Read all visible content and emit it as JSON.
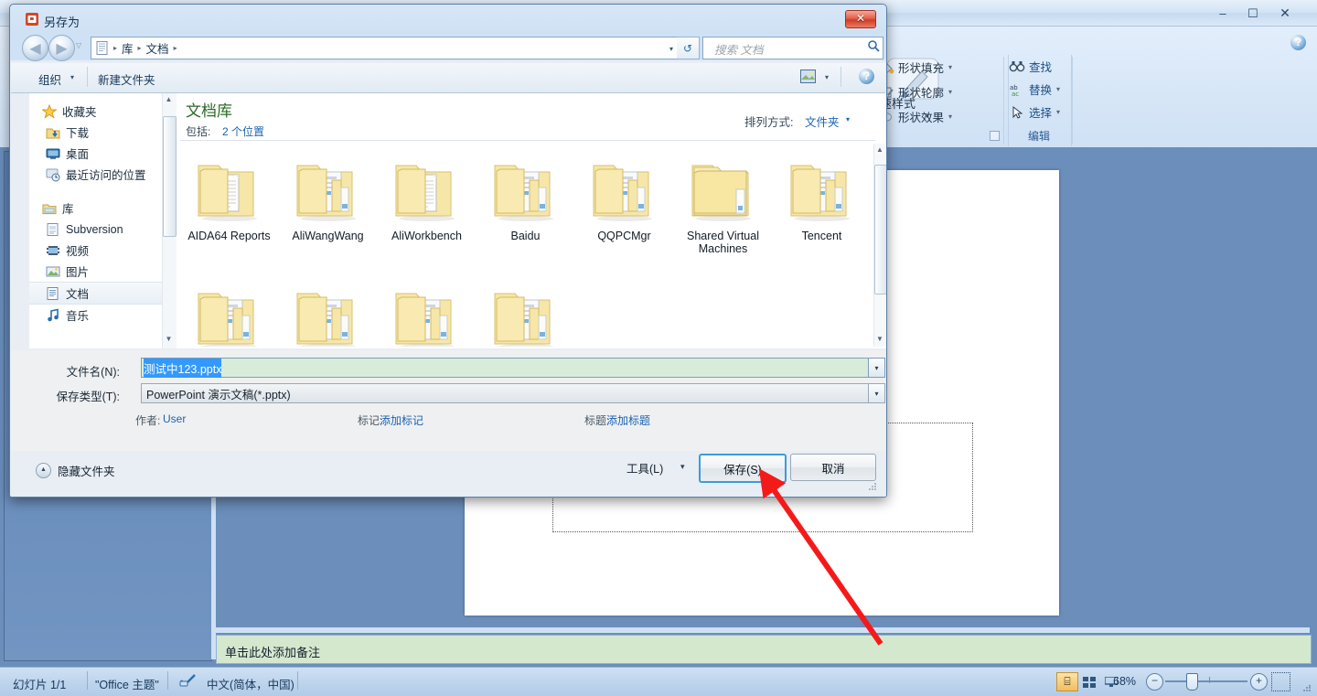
{
  "ppt": {
    "window_buttons": {
      "minimize": "–",
      "maximize": "☐",
      "close": "✕"
    },
    "ribbon": {
      "shape_group": [
        {
          "label": "形状填充",
          "icon": "fill-bucket-icon",
          "caret": "▾"
        },
        {
          "label": "形状轮廓",
          "icon": "shape-outline-icon",
          "caret": "▾"
        },
        {
          "label": "形状效果",
          "icon": "shape-effects-icon",
          "caret": "▾"
        }
      ],
      "quick_styles_label": "速样式",
      "quick_styles_caret": "▾",
      "edit_group": {
        "title": "编辑",
        "items": [
          {
            "label": "查找",
            "icon": "binoculars-icon",
            "caret": ""
          },
          {
            "label": "替换",
            "icon": "replace-abc-icon",
            "caret": "▾"
          },
          {
            "label": "选择",
            "icon": "cursor-arrow-icon",
            "caret": "▾"
          }
        ]
      },
      "help_icon": "?"
    },
    "notes_placeholder": "单击此处添加备注",
    "statusbar": {
      "slide": "幻灯片 1/1",
      "theme": "\"Office 主题\"",
      "language": "中文(简体，中国)",
      "spell_icon": "spellcheck-icon",
      "zoom": "68%",
      "zoom_out": "−",
      "zoom_in": "+",
      "view_buttons": [
        {
          "name": "normal-view",
          "glyph": "⌸",
          "active": true
        },
        {
          "name": "slide-sorter-view",
          "glyph": "░",
          "active": false
        },
        {
          "name": "slideshow-view",
          "glyph": "☰",
          "active": false
        }
      ],
      "fit_button": "fit-slide-icon"
    }
  },
  "dialog": {
    "title": "另存为",
    "app_icon": "powerpoint-icon",
    "close_label": "✕",
    "nav": {
      "back": "◀",
      "forward": "▶",
      "history_caret": "▽",
      "address_icon": "document-library-icon",
      "breadcrumbs": [
        "库",
        "文档"
      ],
      "breadcrumb_sep": "▸",
      "address_dropdown": "▾",
      "refresh": "↺",
      "search_placeholder": "搜索 文档",
      "search_icon": "search-icon"
    },
    "commandbar": {
      "organize": "组织",
      "organize_caret": "▾",
      "new_folder": "新建文件夹",
      "view_icon": "view-layout-icon",
      "view_caret": "▾",
      "help_icon": "?"
    },
    "navpane": {
      "groups": [
        {
          "header": {
            "label": "收藏夹",
            "icon": "star-icon"
          },
          "items": [
            {
              "label": "下载",
              "icon": "downloads-icon",
              "selected": false
            },
            {
              "label": "桌面",
              "icon": "desktop-icon",
              "selected": false
            },
            {
              "label": "最近访问的位置",
              "icon": "recent-places-icon",
              "selected": false
            }
          ]
        },
        {
          "header": {
            "label": "库",
            "icon": "library-icon"
          },
          "items": [
            {
              "label": "Subversion",
              "icon": "subversion-icon",
              "selected": false
            },
            {
              "label": "视频",
              "icon": "video-icon",
              "selected": false
            },
            {
              "label": "图片",
              "icon": "pictures-icon",
              "selected": false
            },
            {
              "label": "文档",
              "icon": "documents-icon",
              "selected": true
            },
            {
              "label": "音乐",
              "icon": "music-icon",
              "selected": false
            }
          ]
        }
      ],
      "scroll_up": "▲",
      "scroll_down": "▼"
    },
    "filepane": {
      "library_title": "文档库",
      "includes_label": "包括:",
      "includes_value": "2 个位置",
      "arrange_label": "排列方式:",
      "arrange_value": "文件夹",
      "arrange_caret": "▾",
      "folders": [
        {
          "name": "AIDA64 Reports",
          "type": "single"
        },
        {
          "name": "AliWangWang",
          "type": "stack"
        },
        {
          "name": "AliWorkbench",
          "type": "single"
        },
        {
          "name": "Baidu",
          "type": "stack"
        },
        {
          "name": "QQPCMgr",
          "type": "stack"
        },
        {
          "name": "Shared Virtual Machines",
          "type": "plain"
        },
        {
          "name": "Tencent",
          "type": "stack"
        },
        {
          "name": "",
          "type": "stack"
        },
        {
          "name": "",
          "type": "stack"
        },
        {
          "name": "",
          "type": "stack"
        },
        {
          "name": "",
          "type": "stack"
        }
      ],
      "scroll_up": "▲",
      "scroll_down": "▼"
    },
    "form": {
      "filename_label": "文件名(N):",
      "filename_value": "测试中123.pptx",
      "filename_caret": "▾",
      "filetype_label": "保存类型(T):",
      "filetype_value": "PowerPoint 演示文稿(*.pptx)",
      "filetype_caret": "▾",
      "meta": [
        {
          "label": "作者:",
          "value": "User"
        },
        {
          "label": "标记:",
          "value": "添加标记"
        },
        {
          "label": "标题:",
          "value": "添加标题"
        }
      ]
    },
    "footer": {
      "hide_folders": "隐藏文件夹",
      "hide_folders_caret": "▲",
      "tools": "工具(L)",
      "tools_caret": "▾",
      "save": "保存(S)",
      "cancel": "取消"
    }
  },
  "annotation": {
    "arrow_color": "#f51a1a",
    "arrow_name": "pointer-arrow-to-save"
  }
}
